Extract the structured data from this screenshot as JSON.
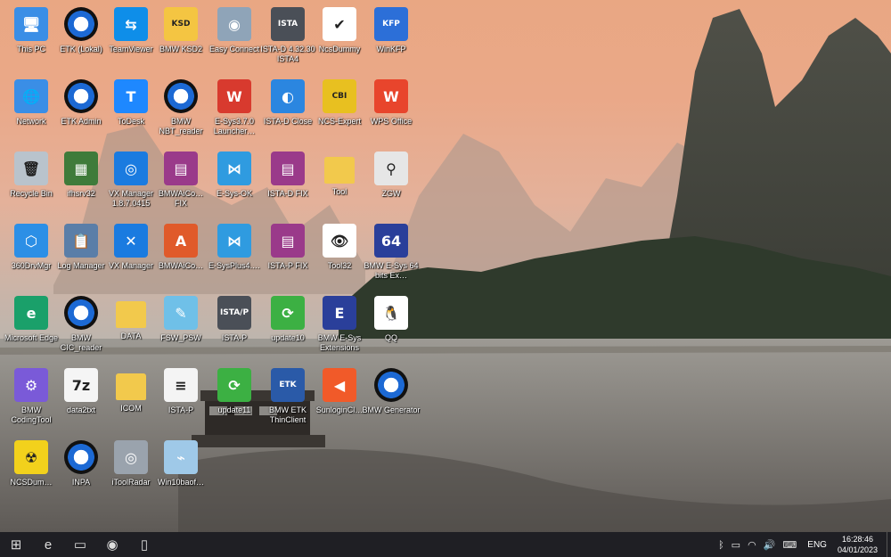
{
  "desktop": {
    "icons": [
      {
        "id": "this-pc",
        "label": "This PC",
        "icon": "computer-icon",
        "color": "#3a8ee6",
        "glyph": "🖥"
      },
      {
        "id": "etk-lokal",
        "label": "ETK (Lokal)",
        "icon": "bmw-logo-icon",
        "color": "#1c69d4",
        "glyph": "BMW"
      },
      {
        "id": "teamviewer",
        "label": "TeamViewer",
        "icon": "teamviewer-icon",
        "color": "#0e8ee9",
        "glyph": "⇆"
      },
      {
        "id": "bmw-ksd2",
        "label": "BMW KSD2",
        "icon": "ksd2-icon",
        "color": "#f4c542",
        "glyph": "KSD"
      },
      {
        "id": "easy-connect",
        "label": "Easy Connect",
        "icon": "globe-icon",
        "color": "#8fa4b8",
        "glyph": "◉"
      },
      {
        "id": "ista-d",
        "label": "ISTA-D 4.32.30 ISTA4",
        "icon": "ista-icon",
        "color": "#4a4f57",
        "glyph": "ISTA"
      },
      {
        "id": "ncsdummy",
        "label": "NcsDummy",
        "icon": "checkbox-icon",
        "color": "#ffffff",
        "glyph": "✔"
      },
      {
        "id": "winkfp",
        "label": "WinKFP",
        "icon": "kfp-icon",
        "color": "#2c6fd8",
        "glyph": "KFP"
      },
      {
        "id": "network",
        "label": "Network",
        "icon": "network-icon",
        "color": "#3a8ee6",
        "glyph": "🌐"
      },
      {
        "id": "etk-admin",
        "label": "ETK Admin",
        "icon": "bmw-logo-icon",
        "color": "#1c69d4",
        "glyph": "BMW"
      },
      {
        "id": "todesk",
        "label": "ToDesk",
        "icon": "todesk-icon",
        "color": "#1e88ff",
        "glyph": "T"
      },
      {
        "id": "bmw-nbt-reader",
        "label": "BMW NBT_reader",
        "icon": "bmw-logo-icon",
        "color": "#1c69d4",
        "glyph": "BMW"
      },
      {
        "id": "esys-launcher",
        "label": "E-Sys3.7.0 Launcher…",
        "icon": "esys-launcher-icon",
        "color": "#d83a2e",
        "glyph": "W"
      },
      {
        "id": "ista-d-close",
        "label": "ISTA-D Close",
        "icon": "ista-close-icon",
        "color": "#2b86e0",
        "glyph": "◐"
      },
      {
        "id": "ncs-expert",
        "label": "NCS-Expert",
        "icon": "ncs-expert-icon",
        "color": "#e8c020",
        "glyph": "CBI"
      },
      {
        "id": "wps-office",
        "label": "WPS Office",
        "icon": "wps-icon",
        "color": "#e8452c",
        "glyph": "W"
      },
      {
        "id": "recycle-bin",
        "label": "Recycle Bin",
        "icon": "recycle-bin-icon",
        "color": "#b9c3cc",
        "glyph": "🗑"
      },
      {
        "id": "ifhsrv32",
        "label": "ifhsrv32",
        "icon": "server-icon",
        "color": "#3f7b3a",
        "glyph": "▦"
      },
      {
        "id": "vx-manager-1",
        "label": "VX Manager 1.8.7.0415",
        "icon": "vx-manager-icon",
        "color": "#1a7be0",
        "glyph": "◎"
      },
      {
        "id": "bmwaico-fix",
        "label": "BMWAiCo… FIX",
        "icon": "winrar-icon",
        "color": "#9a3a8a",
        "glyph": "▤"
      },
      {
        "id": "esys-ok",
        "label": "E-Sys-OK",
        "icon": "esys-icon",
        "color": "#2f9be0",
        "glyph": "⋈"
      },
      {
        "id": "ista-d-fix",
        "label": "ISTA-D FIX",
        "icon": "winrar-icon",
        "color": "#9a3a8a",
        "glyph": "▤"
      },
      {
        "id": "tool",
        "label": "Tool",
        "icon": "folder-icon",
        "color": "#f2c94c",
        "glyph": ""
      },
      {
        "id": "zgw",
        "label": "ZGW",
        "icon": "binoculars-icon",
        "color": "#e6e6e6",
        "glyph": "⚲"
      },
      {
        "id": "360drvmgr",
        "label": "360DrvMgr",
        "icon": "driver-manager-icon",
        "color": "#2c8fe6",
        "glyph": "⬡"
      },
      {
        "id": "log-manager",
        "label": "Log Manager",
        "icon": "clipboard-icon",
        "color": "#5a7ea8",
        "glyph": "📋"
      },
      {
        "id": "vx-manager-2",
        "label": "VX Manager",
        "icon": "vx-icon",
        "color": "#1a7be0",
        "glyph": "✕"
      },
      {
        "id": "bmwaico",
        "label": "BMWAiCo…",
        "icon": "bmw-aicoder-icon",
        "color": "#e05a2a",
        "glyph": "A"
      },
      {
        "id": "esysplus",
        "label": "E-SysPlus4.…",
        "icon": "esysplus-icon",
        "color": "#2f9be0",
        "glyph": "⋈"
      },
      {
        "id": "ista-p-fix",
        "label": "ISTA-P FIX",
        "icon": "winrar-icon",
        "color": "#9a3a8a",
        "glyph": "▤"
      },
      {
        "id": "tool32",
        "label": "Tool32",
        "icon": "eye-icon",
        "color": "#ffffff",
        "glyph": "👁"
      },
      {
        "id": "bmw-esys-64",
        "label": "BMW E-Sys 64 bits Ex…",
        "icon": "esys-64-icon",
        "color": "#2a3f9a",
        "glyph": "64"
      },
      {
        "id": "microsoft-edge",
        "label": "Microsoft Edge",
        "icon": "edge-icon",
        "color": "#1aa06a",
        "glyph": "e"
      },
      {
        "id": "bmw-cic-reader",
        "label": "BMW CIC_reader",
        "icon": "bmw-logo-icon",
        "color": "#1c69d4",
        "glyph": "BMW"
      },
      {
        "id": "data",
        "label": "DATA",
        "icon": "folder-icon",
        "color": "#f2c94c",
        "glyph": ""
      },
      {
        "id": "fsw-psw",
        "label": "FSW_PSW",
        "icon": "notepad-icon",
        "color": "#6fc0e8",
        "glyph": "✎"
      },
      {
        "id": "ista-p",
        "label": "ISTA-P",
        "icon": "ista-p-icon",
        "color": "#4a4f57",
        "glyph": "ISTA/P"
      },
      {
        "id": "update10",
        "label": "update10",
        "icon": "refresh-icon",
        "color": "#3cb043",
        "glyph": "⟳"
      },
      {
        "id": "bmw-esys-ext",
        "label": "BMW E-Sys Extensions",
        "icon": "esys-ext-icon",
        "color": "#2a3f9a",
        "glyph": "E"
      },
      {
        "id": "qq",
        "label": "QQ",
        "icon": "qq-penguin-icon",
        "color": "#ffffff",
        "glyph": "🐧"
      },
      {
        "id": "bmw-codingtool",
        "label": "BMW CodingTool",
        "icon": "coding-tool-icon",
        "color": "#7a5ad8",
        "glyph": "⚙"
      },
      {
        "id": "data2txt",
        "label": "data2txt",
        "icon": "seven-zip-icon",
        "color": "#f5f5f5",
        "glyph": "7z"
      },
      {
        "id": "icom",
        "label": "ICOM",
        "icon": "folder-icon",
        "color": "#f2c94c",
        "glyph": ""
      },
      {
        "id": "ista-p-2",
        "label": "ISTA-P",
        "icon": "document-icon",
        "color": "#f4f4f4",
        "glyph": "≡"
      },
      {
        "id": "update11",
        "label": "update11",
        "icon": "refresh-icon",
        "color": "#3cb043",
        "glyph": "⟳"
      },
      {
        "id": "bmw-etk-thinclient",
        "label": "BMW ETK ThinClient",
        "icon": "etk-icon",
        "color": "#2a5aa8",
        "glyph": "ETK"
      },
      {
        "id": "sunlogin",
        "label": "SunloginCl…",
        "icon": "sunlogin-icon",
        "color": "#f15a29",
        "glyph": "◀"
      },
      {
        "id": "bmw-generator",
        "label": "BMW Generator",
        "icon": "bmw-logo-icon",
        "color": "#1c69d4",
        "glyph": "BMW"
      },
      {
        "id": "ncsdummy-2",
        "label": "NCSDum…",
        "icon": "radiation-icon",
        "color": "#f2d11c",
        "glyph": "☢"
      },
      {
        "id": "inpa",
        "label": "INPA",
        "icon": "inpa-icon",
        "color": "#1c69d4",
        "glyph": "BMW"
      },
      {
        "id": "itoolradar",
        "label": "iToolRadar",
        "icon": "radar-icon",
        "color": "#9aa3ad",
        "glyph": "◎"
      },
      {
        "id": "win10baof",
        "label": "Win10baof…",
        "icon": "tornado-icon",
        "color": "#9fc9e8",
        "glyph": "⌁"
      }
    ]
  },
  "taskbar": {
    "items": [
      {
        "id": "start",
        "icon": "windows-start-icon",
        "glyph": "⊞"
      },
      {
        "id": "edge",
        "icon": "edge-icon",
        "glyph": "e"
      },
      {
        "id": "explorer",
        "icon": "file-explorer-icon",
        "glyph": "▭"
      },
      {
        "id": "easy-connect",
        "icon": "globe-icon",
        "glyph": "◉"
      },
      {
        "id": "device",
        "icon": "device-icon",
        "glyph": "▯"
      }
    ],
    "tray": [
      {
        "id": "bluetooth",
        "icon": "bluetooth-icon",
        "glyph": "ᛒ"
      },
      {
        "id": "battery",
        "icon": "battery-icon",
        "glyph": "▭"
      },
      {
        "id": "network",
        "icon": "wifi-icon",
        "glyph": "◠"
      },
      {
        "id": "volume",
        "icon": "volume-icon",
        "glyph": "🔊"
      },
      {
        "id": "keyboard",
        "icon": "keyboard-icon",
        "glyph": "⌨"
      }
    ],
    "language": "ENG",
    "time": "16:28:46",
    "date": "04/01/2023"
  }
}
